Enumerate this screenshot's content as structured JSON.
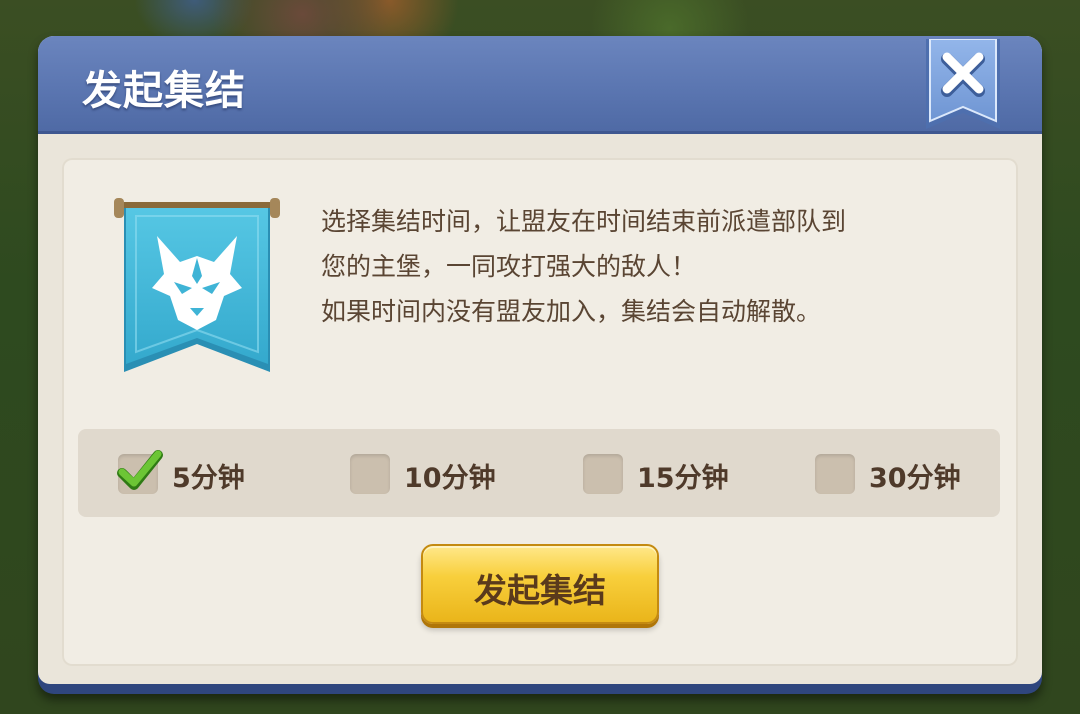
{
  "dialog": {
    "title": "发起集结",
    "close_icon": "close-x-icon"
  },
  "banner": {
    "icon": "wolf-banner-icon",
    "color": "#3fb8d8"
  },
  "description": {
    "lines": [
      "选择集结时间，让盟友在时间结束前派遣部队到",
      "您的主堡，一同攻打强大的敌人！",
      "如果时间内没有盟友加入，集结会自动解散。"
    ]
  },
  "time_options": [
    {
      "label": "5分钟",
      "checked": true
    },
    {
      "label": "10分钟",
      "checked": false
    },
    {
      "label": "15分钟",
      "checked": false
    },
    {
      "label": "30分钟",
      "checked": false
    }
  ],
  "action_button": {
    "label": "发起集结",
    "color": "#f8cf3c"
  },
  "colors": {
    "title_bar": "#5b76b1",
    "panel": "#f1ede4",
    "check": "#5fb82e",
    "text": "#5a4533"
  }
}
